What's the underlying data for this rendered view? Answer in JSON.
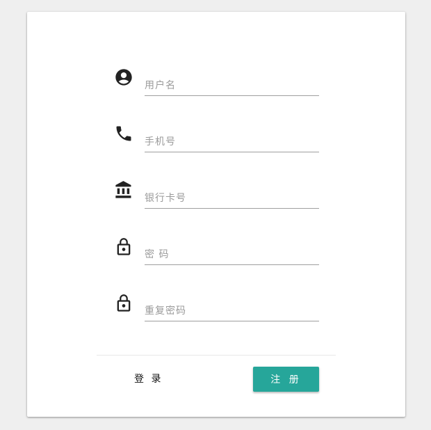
{
  "form": {
    "fields": [
      {
        "icon": "account-circle-icon",
        "placeholder": "用户名",
        "value": ""
      },
      {
        "icon": "phone-icon",
        "placeholder": "手机号",
        "value": ""
      },
      {
        "icon": "bank-icon",
        "placeholder": "银行卡号",
        "value": ""
      },
      {
        "icon": "lock-icon",
        "placeholder": "密 码",
        "value": ""
      },
      {
        "icon": "lock-icon",
        "placeholder": "重复密码",
        "value": ""
      }
    ]
  },
  "actions": {
    "login_label": "登 录",
    "register_label": "注 册"
  },
  "colors": {
    "background": "#efefef",
    "card": "#ffffff",
    "accent": "#26a69a",
    "icon": "#222222"
  }
}
